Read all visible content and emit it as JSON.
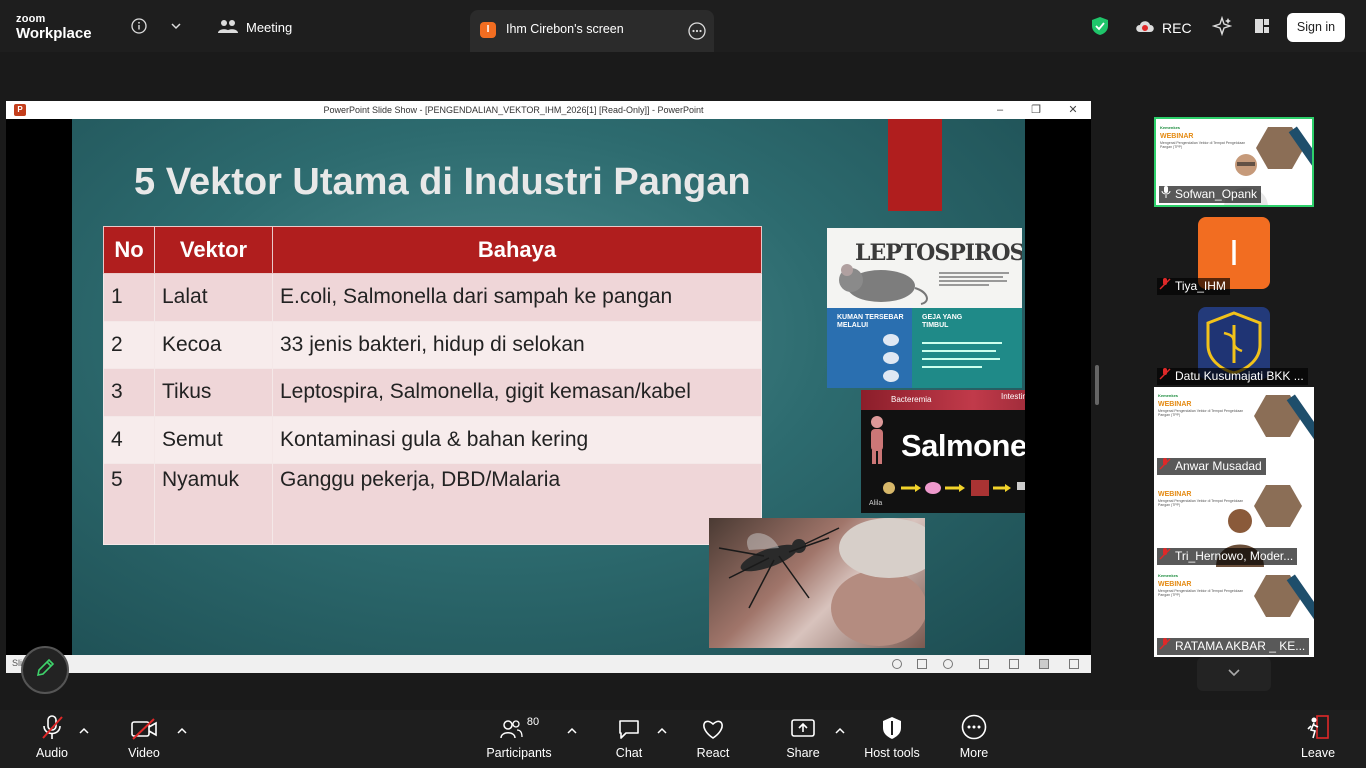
{
  "topbar": {
    "logo_line1": "zoom",
    "logo_line2": "Workplace",
    "meeting_label": "Meeting",
    "shared_screen_badge": "I",
    "shared_screen_title": "Ihm Cirebon's screen",
    "rec_label": "REC",
    "signin_label": "Sign in"
  },
  "ppt": {
    "window_title": "PowerPoint Slide Show - [PENGENDALIAN_VEKTOR_IHM_2026[1] [Read-Only]] - PowerPoint",
    "status_text": "Sli",
    "slide": {
      "title": "5 Vektor Utama di Industri Pangan",
      "table": {
        "headers": [
          "No",
          "Vektor",
          "Bahaya"
        ],
        "rows": [
          [
            "1",
            "Lalat",
            "E.coli, Salmonella dari sampah ke pangan"
          ],
          [
            "2",
            "Kecoa",
            "33 jenis bakteri, hidup di selokan"
          ],
          [
            "3",
            "Tikus",
            "Leptospira, Salmonella, gigit kemasan/kabel"
          ],
          [
            "4",
            "Semut",
            "Kontaminasi gula & bahan kering"
          ],
          [
            "5",
            "Nyamuk",
            "Ganggu pekerja, DBD/Malaria"
          ]
        ]
      },
      "img_lepto": {
        "title": "LEPTOSPIROSIS",
        "left_heading": "KUMAN TERSEBAR MELALUI",
        "right_heading": "GEJA YANG TIMBUL"
      },
      "img_salmonella": {
        "title": "Salmonella",
        "label_left": "Bacteremia",
        "label_right": "Intestinal infection",
        "caption": "Alila"
      }
    }
  },
  "participants": [
    {
      "name": "Sofwan_Opank"
    },
    {
      "name": "Tiya_IHM",
      "initial": "I"
    },
    {
      "name": "Datu Kusumajati BKK ..."
    },
    {
      "name": "Anwar Musadad"
    },
    {
      "name": "Tri_Hernowo, Moder..."
    },
    {
      "name": "RATAMA AKBAR _ KE..."
    }
  ],
  "webinar_thumb": {
    "org": "Kemenkes",
    "heading": "WEBINAR",
    "subtitle": "Mengenal Pengendalian Vektor di Tempat Pengelolaan Pangan (TPP)",
    "date": "23 APRIL 2026"
  },
  "toolbar": {
    "audio": "Audio",
    "video": "Video",
    "participants": "Participants",
    "participants_count": "80",
    "chat": "Chat",
    "react": "React",
    "share": "Share",
    "host_tools": "Host tools",
    "more": "More",
    "leave": "Leave"
  },
  "colors": {
    "accent_red": "#b01e1e",
    "zoom_orange": "#f26d21",
    "active_speaker": "#2dd06b",
    "muted_red": "#e02828"
  }
}
